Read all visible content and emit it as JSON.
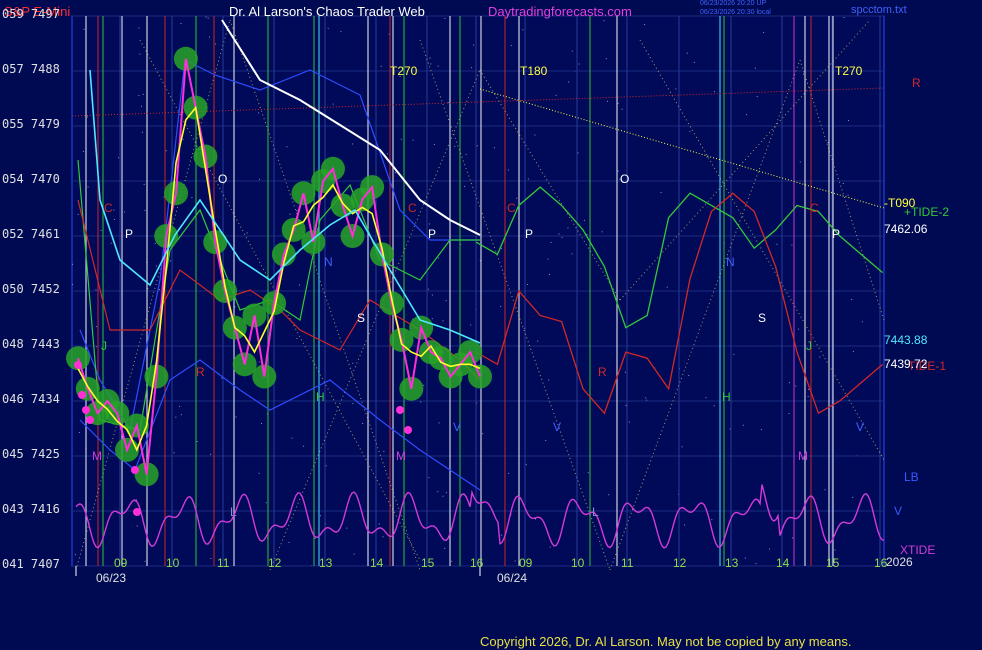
{
  "header": {
    "instrument": "S&P E-Mini",
    "site": "Dr. Al Larson's Chaos Trader Web",
    "url": "Daytradingforecasts.com",
    "timestamp1": "06/23/2026 20:20 UP",
    "timestamp2": "06/23/2026 20:30 local",
    "file": "spcctom.txt"
  },
  "y_axis": {
    "labels": [
      {
        "left": "059",
        "right": "7497"
      },
      {
        "left": "057",
        "right": "7488"
      },
      {
        "left": "055",
        "right": "7479"
      },
      {
        "left": "054",
        "right": "7470"
      },
      {
        "left": "052",
        "right": "7461"
      },
      {
        "left": "050",
        "right": "7452"
      },
      {
        "left": "048",
        "right": "7443"
      },
      {
        "left": "046",
        "right": "7434"
      },
      {
        "left": "045",
        "right": "7425"
      },
      {
        "left": "043",
        "right": "7416"
      },
      {
        "left": "041",
        "right": "7407"
      }
    ]
  },
  "x_axis": {
    "hours": [
      "09",
      "10",
      "11",
      "12",
      "13",
      "14",
      "15",
      "16",
      "09",
      "10",
      "11",
      "12",
      "13",
      "14",
      "15",
      "16"
    ],
    "dates": [
      "06/23",
      "06/24"
    ],
    "year": "2026"
  },
  "right_labels": {
    "r": "R",
    "t090": "-T090",
    "tide2": "+TIDE-2",
    "price1": "7462.06",
    "price2": "7443.88",
    "price3": "7439.72",
    "tide1": "TIDE-1",
    "lb": "LB",
    "v": "V",
    "xtide": "XTIDE"
  },
  "cycle_labels": {
    "t270a": "T270",
    "t180": "T180",
    "t270b": "T270"
  },
  "copyright": "Copyright 2026, Dr. Al Larson. May not be copied by any means.",
  "colors": {
    "bg": "#000a52",
    "price": "#ff2fd8",
    "yellow": "#ffff2a",
    "cyan": "#4fe8ff",
    "green": "#34c83a",
    "red": "#d22828",
    "blue": "#2f4cff",
    "magenta": "#d23ad8",
    "white": "#ffffff",
    "glow": "#27a527"
  },
  "chart_data": {
    "type": "line",
    "title": "S&P E-Mini",
    "y_ticks": [
      7497,
      7488,
      7479,
      7470,
      7461,
      7452,
      7443,
      7434,
      7425,
      7416,
      7407
    ],
    "ylim": [
      7407,
      7497
    ],
    "x_ticks": [
      "09",
      "10",
      "11",
      "12",
      "13",
      "14",
      "15",
      "16",
      "09",
      "10",
      "11",
      "12",
      "13",
      "14",
      "15",
      "16"
    ],
    "dates": [
      "06/23",
      "06/24"
    ],
    "last_values": {
      "TIDE-2": 7462.06,
      "cyan_average": 7443.88,
      "TIDE-1": 7439.72
    },
    "series": [
      {
        "name": "price",
        "values": [
          7441,
          7436,
          7432,
          7434,
          7432,
          7426,
          7430,
          7422,
          7438,
          7461,
          7468,
          7490,
          7482,
          7474,
          7460,
          7452,
          7446,
          7440,
          7448,
          7438,
          7450,
          7458,
          7462,
          7468,
          7460,
          7470,
          7472,
          7466,
          7461,
          7467,
          7469,
          7458,
          7450,
          7444,
          7436,
          7446,
          7442,
          7441,
          7438,
          7440,
          7442,
          7438
        ]
      },
      {
        "name": "TIDE-2",
        "values": [
          7460,
          7458,
          7466,
          7469,
          7466,
          7462,
          7456,
          7446,
          7448,
          7464,
          7468,
          7466,
          7464,
          7459,
          7462,
          7466,
          7465,
          7461,
          7458,
          7455
        ]
      },
      {
        "name": "TIDE-1",
        "values": [
          7442,
          7440,
          7452,
          7448,
          7447,
          7436,
          7432,
          7442,
          7441,
          7436,
          7454,
          7465,
          7468,
          7465,
          7456,
          7442,
          7432,
          7434,
          7437,
          7440
        ]
      },
      {
        "name": "XTIDE",
        "values": [
          7420,
          7414,
          7413,
          7410,
          7418,
          7411,
          7414,
          7412,
          7419,
          7410,
          7416,
          7411,
          7415,
          7412,
          7417,
          7411,
          7409
        ]
      }
    ]
  }
}
